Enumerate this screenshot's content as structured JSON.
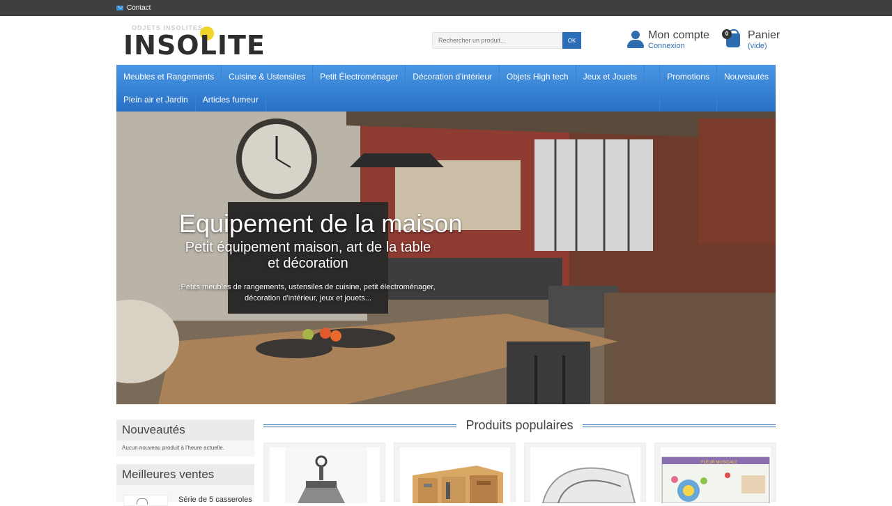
{
  "topbar": {
    "contact_label": "Contact"
  },
  "header": {
    "logo_text": "INSOLITE",
    "logo_faded_text": "ODJETS INSOLITES",
    "search": {
      "placeholder": "Rechercher un produit...",
      "button_label": "OK"
    },
    "account": {
      "title": "Mon compte",
      "subtitle": "Connexion"
    },
    "cart": {
      "title": "Panier",
      "subtitle": "(vide)",
      "count": "0"
    }
  },
  "nav": {
    "row1": [
      "Meubles et Rangements",
      "Cuisine & Ustensiles",
      "Petit Électroménager",
      "Décoration d'intérieur",
      "Objets High tech",
      "Jeux et Jouets"
    ],
    "row2": [
      "Plein air et Jardin",
      "Articles fumeur"
    ],
    "right": [
      "Promotions",
      "Nouveautés"
    ]
  },
  "hero": {
    "title": "Equipement de la maison",
    "subtitle": "Petit équipement maison, art de la table et décoration",
    "description": "Petits meubles de rangements, ustensiles de cuisine, petit électroménager, décoration d'intérieur, jeux et jouets..."
  },
  "sidebar": {
    "new_products": {
      "title": "Nouveautés",
      "text": "Aucun nouveau produit à l'heure actuelle."
    },
    "best_sellers": {
      "title": "Meilleures ventes",
      "item_name": "Série de 5 casseroles"
    }
  },
  "popular": {
    "title": "Produits populaires",
    "image_texts": [
      "FLEUR MUSICALE"
    ]
  },
  "colors": {
    "accent": "#2d6cae",
    "nav_top": "#4a97e4",
    "nav_bottom": "#2870c5",
    "topbar": "#3f3f3f"
  }
}
